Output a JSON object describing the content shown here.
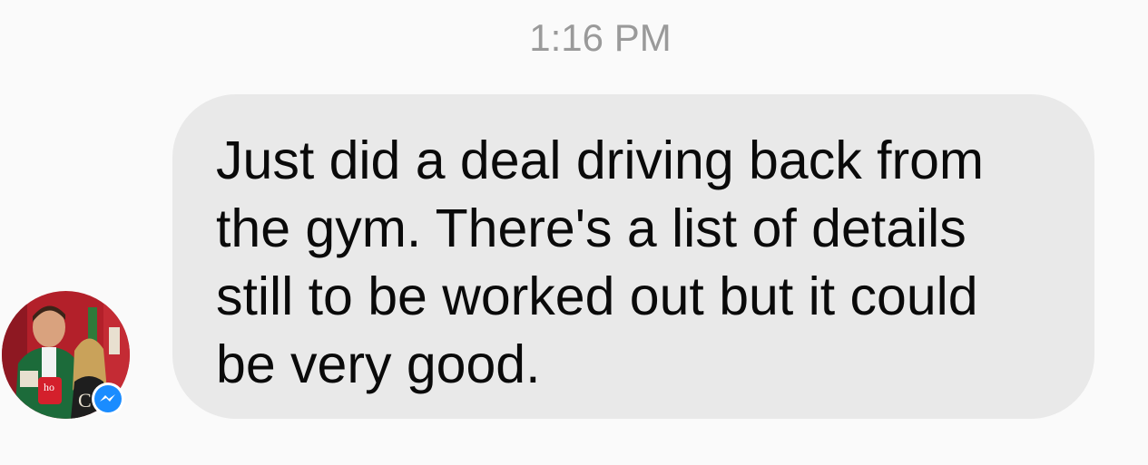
{
  "thread": {
    "timestamp": "1:16 PM"
  },
  "message": {
    "text": "Just did a deal driving back from\nthe gym. There's a list of details\nstill to be worked out but it could\nbe very good.",
    "direction": "incoming",
    "bubble_color": "#e9e9e9"
  },
  "sender": {
    "avatar_icon": "sender-avatar-photo",
    "badge_icon": "messenger-icon",
    "badge_color": "#1a8cff"
  }
}
